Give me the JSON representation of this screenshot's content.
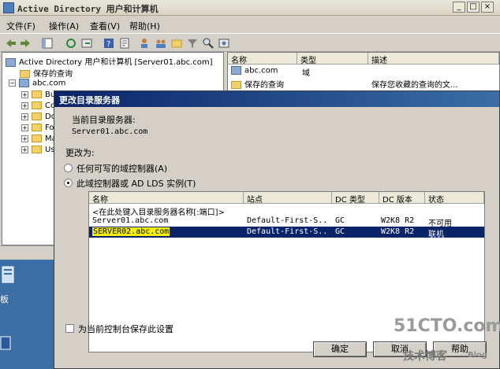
{
  "window": {
    "title": "Active Directory 用户和计算机"
  },
  "menu": [
    "文件(F)",
    "操作(A)",
    "查看(V)",
    "帮助(H)"
  ],
  "tree": {
    "root": "Active Directory 用户和计算机 [Server01.abc.com]",
    "saved_queries": "保存的查询",
    "domain": "abc.com",
    "children": [
      "Bu",
      "Co",
      "Do",
      "Fo",
      "Ma",
      "Us"
    ]
  },
  "list": {
    "headers": [
      "名称",
      "类型",
      "描述"
    ],
    "rows": [
      {
        "name": "abc.com",
        "type": "域",
        "desc": ""
      },
      {
        "name": "保存的查询",
        "type": "",
        "desc": "保存您收藏的查询的文..."
      }
    ]
  },
  "desktop": {
    "label": "板"
  },
  "dialog": {
    "title": "更改目录服务器",
    "current_label": "当前目录服务器:",
    "current_value": "Server01.abc.com",
    "change_to": "更改为:",
    "radio_any": "任何可写的域控制器(A)",
    "radio_this": "此域控制器或 AD LDS 实例(T)",
    "columns": [
      "名称",
      "站点",
      "DC 类型",
      "DC 版本",
      "状态"
    ],
    "rows": [
      {
        "name": "<在此处键入目录服务器名称[:端口]>",
        "site": "",
        "dctype": "",
        "dcver": "",
        "status": ""
      },
      {
        "name": "Server01.abc.com",
        "site": "Default-First-S...",
        "dctype": "GC",
        "dcver": "W2K8 R2",
        "status": "不可用"
      },
      {
        "name": "SERVER02.abc.com",
        "site": "Default-First-S...",
        "dctype": "GC",
        "dcver": "W2K8 R2",
        "status": "联机"
      }
    ],
    "save_setting": "为当前控制台保存此设置",
    "ok": "确定",
    "cancel": "取消",
    "help": "帮助"
  },
  "watermark": {
    "site": "51CTO.com",
    "blog": "技术博客",
    "blog_en": "Blog"
  }
}
